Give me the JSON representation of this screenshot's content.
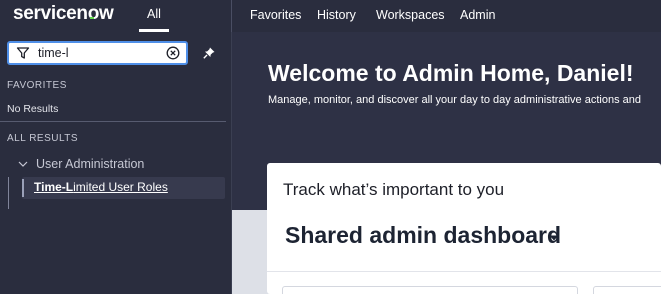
{
  "header": {
    "logo_text_left": "servicen",
    "logo_text_o": "o",
    "logo_text_right": "w",
    "all_tab": "All",
    "nav": [
      "Favorites",
      "History",
      "Workspaces",
      "Admin"
    ]
  },
  "sidebar": {
    "search": {
      "value": "time-l"
    },
    "favorites_label": "FAVORITES",
    "no_results": "No Results",
    "all_results_label": "ALL RESULTS",
    "group": "User Administration",
    "result": {
      "match": "Time-L",
      "rest": "imited User Roles"
    }
  },
  "main": {
    "welcome_title": "Welcome to Admin Home, Daniel!",
    "welcome_subtitle": "Manage, monitor, and discover all your day to day administrative actions and",
    "card_title": "Track what’s important to you",
    "dashboard_name": "Shared admin dashboard"
  },
  "colors": {
    "header_bg": "#2a2d3e",
    "accent_green": "#62d84e",
    "focus_blue": "#4f8fe8",
    "lower_bg": "#dde0e7"
  },
  "icons": {
    "filter": "filter-icon",
    "clear": "clear-circle-x-icon",
    "pin": "pin-icon",
    "chevron": "chevron-down-icon",
    "caret": "caret-down-icon"
  }
}
